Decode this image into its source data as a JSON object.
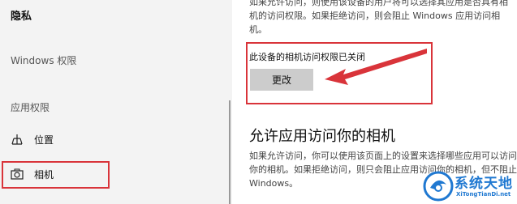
{
  "sidebar": {
    "title": "隐私",
    "windows_permissions": "Windows 权限",
    "app_permissions": "应用权限",
    "items": [
      {
        "label": "位置",
        "icon": "location-icon"
      },
      {
        "label": "相机",
        "icon": "camera-icon"
      }
    ]
  },
  "main": {
    "top_paragraph": "如果允许访问，则使用该设备的用户将可以选择其应用是否具有相机的访问权限。如果拒绝访问，则会阻止 Windows 应用访问相机。",
    "device_status": "此设备的相机访问权限已关闭",
    "change_button": "更改",
    "section_heading": "允许应用访问你的相机",
    "section_paragraph": "如果允许访问，你可以使用该页面上的设置来选择哪些应用可以访问你的相机。如果拒绝访问，则只会阻止应用访问你的相机，但不阻止 Windows。"
  },
  "watermark": {
    "name_cn": "系统天地",
    "url": "XiTongTianDi.net"
  },
  "colors": {
    "highlight_red": "#d9343a",
    "sidebar_bg": "#f3f3f3",
    "button_gray": "#cccccc",
    "watermark_blue": "#1f78d1"
  }
}
